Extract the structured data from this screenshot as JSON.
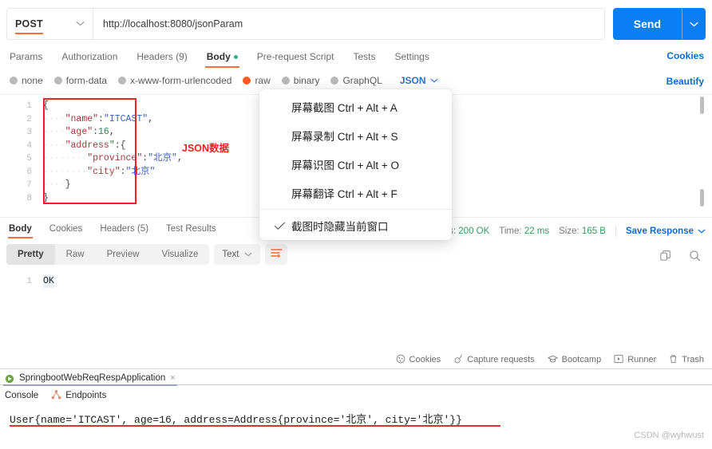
{
  "request": {
    "method": "POST",
    "method_caret": "chevron-down",
    "url": "http://localhost:8080/jsonParam",
    "send_label": "Send",
    "tabs": [
      {
        "label": "Params",
        "active": false
      },
      {
        "label": "Authorization",
        "active": false
      },
      {
        "label": "Headers (9)",
        "active": false
      },
      {
        "label": "Body",
        "active": true
      },
      {
        "label": "Pre-request Script",
        "active": false
      },
      {
        "label": "Tests",
        "active": false
      },
      {
        "label": "Settings",
        "active": false
      }
    ],
    "cookies_link": "Cookies",
    "beautify_link": "Beautify",
    "body_types": [
      {
        "label": "none",
        "selected": false
      },
      {
        "label": "form-data",
        "selected": false
      },
      {
        "label": "x-www-form-urlencoded",
        "selected": false
      },
      {
        "label": "raw",
        "selected": true
      },
      {
        "label": "binary",
        "selected": false
      },
      {
        "label": "GraphQL",
        "selected": false
      }
    ],
    "raw_format": "JSON",
    "editor": {
      "line_numbers": [
        "1",
        "2",
        "3",
        "4",
        "5",
        "6",
        "7",
        "8"
      ],
      "lines": [
        "{",
        "    \"name\":\"ITCAST\",",
        "    \"age\":16,",
        "    \"address\":{",
        "        \"province\":\"北京\",",
        "        \"city\":\"北京\"",
        "    }",
        "}"
      ],
      "annotation": "JSON数据"
    }
  },
  "response": {
    "tabs": [
      {
        "label": "Body",
        "active": true
      },
      {
        "label": "Cookies",
        "active": false
      },
      {
        "label": "Headers (5)",
        "active": false
      },
      {
        "label": "Test Results",
        "active": false
      }
    ],
    "status_label": "Status:",
    "status_value": "200 OK",
    "time_label": "Time:",
    "time_value": "22 ms",
    "size_label": "Size:",
    "size_value": "165 B",
    "save_response": "Save Response",
    "view_modes": [
      {
        "label": "Pretty",
        "active": true
      },
      {
        "label": "Raw",
        "active": false
      },
      {
        "label": "Preview",
        "active": false
      },
      {
        "label": "Visualize",
        "active": false
      }
    ],
    "format": "Text",
    "line_number": "1",
    "body_text": "OK"
  },
  "footer": {
    "items": [
      {
        "label": "Cookies",
        "icon": "cookie-icon"
      },
      {
        "label": "Capture requests",
        "icon": "satellite-icon"
      },
      {
        "label": "Bootcamp",
        "icon": "graduation-cap-icon"
      },
      {
        "label": "Runner",
        "icon": "play-box-icon"
      },
      {
        "label": "Trash",
        "icon": "trash-icon"
      }
    ]
  },
  "popup_menu": {
    "items": [
      {
        "label": "屏幕截图 Ctrl + Alt + A",
        "checked": false
      },
      {
        "label": "屏幕录制 Ctrl + Alt + S",
        "checked": false
      },
      {
        "label": "屏幕识图 Ctrl + Alt + O",
        "checked": false
      },
      {
        "label": "屏幕翻译 Ctrl + Alt + F",
        "checked": false
      },
      {
        "label": "截图时隐藏当前窗口",
        "checked": true
      }
    ]
  },
  "ide": {
    "run_tab": "SpringbootWebReqRespApplication",
    "close_label": "×",
    "subtabs": [
      {
        "label": "Console",
        "icon": "console-icon"
      },
      {
        "label": "Endpoints",
        "icon": "endpoints-icon"
      }
    ],
    "console_output": "User{name='ITCAST', age=16, address=Address{province='北京', city='北京'}}"
  },
  "watermark": "CSDN @wyhwust",
  "colors": {
    "accent_orange": "#ff6c37",
    "send_blue": "#0b7ef4",
    "link_blue": "#0b6bd1",
    "status_green": "#2f9b5e",
    "annotation_red": "#ee2222"
  }
}
